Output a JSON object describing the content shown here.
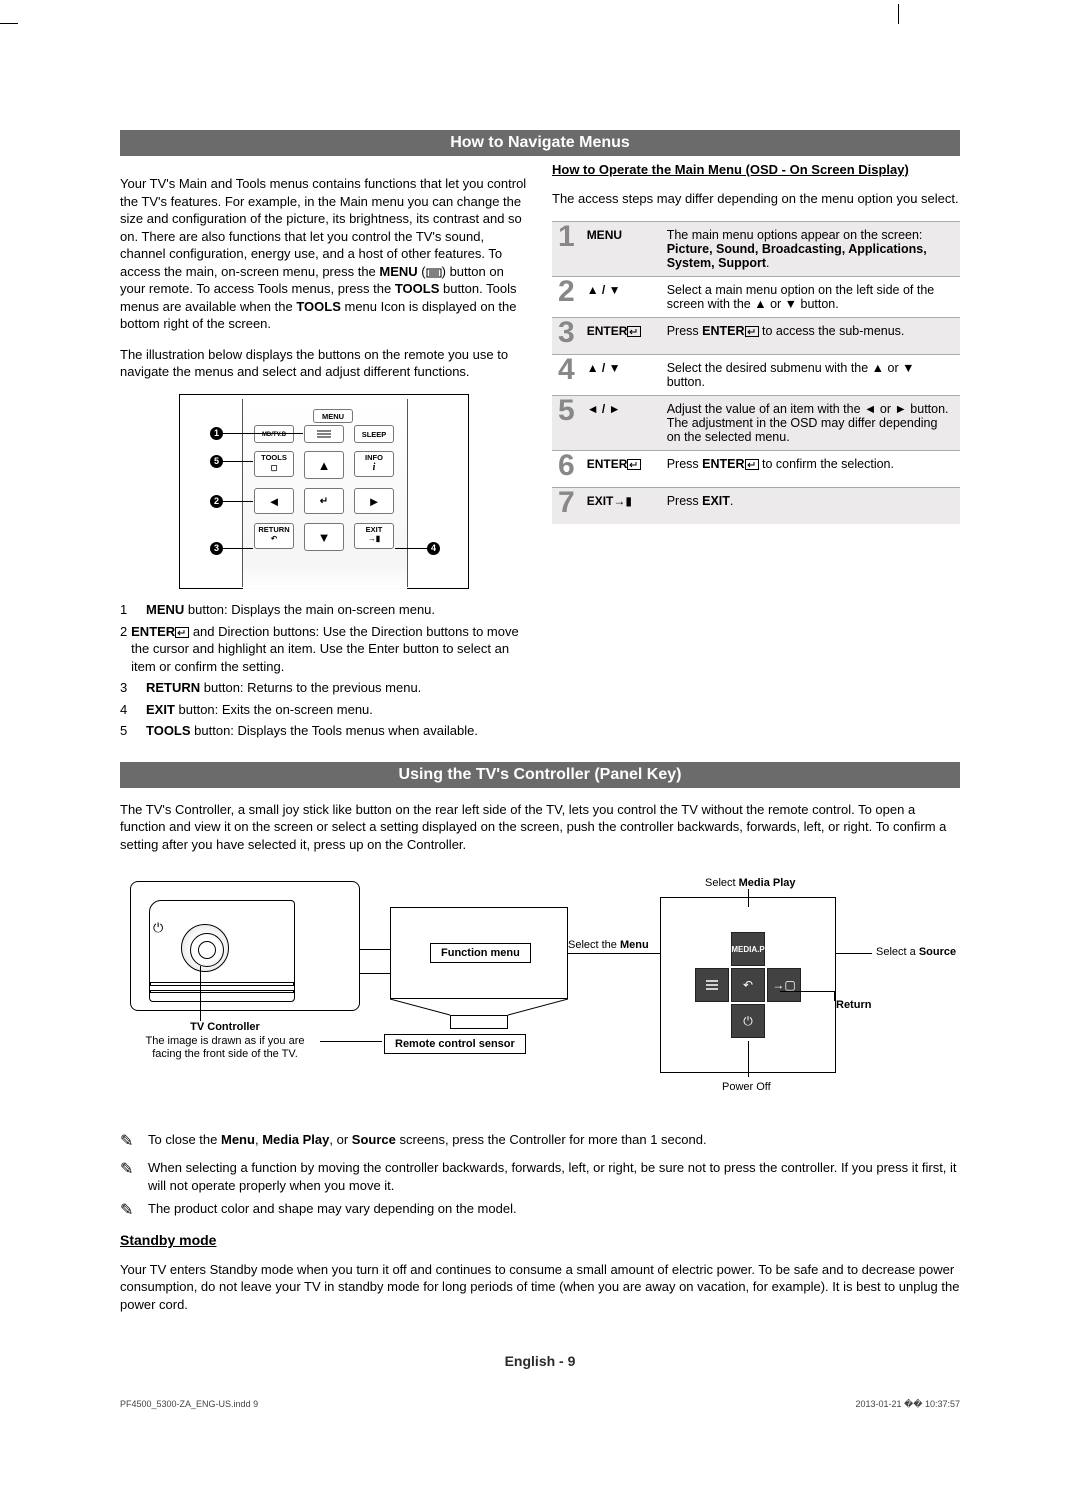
{
  "section1": {
    "title": "How to Navigate Menus",
    "intro1": "Your TV's Main and Tools menus contains functions that let you control the TV's features. For example, in the Main menu you can change the size and configuration of the picture, its brightness, its contrast and so on. There are also functions that let you control the TV's sound, channel configuration, energy use, and a host of other features. To access the main, on-screen menu, press the ",
    "intro1_menu": "MENU",
    "intro1_cont": " (",
    "intro1_end": ") button on your remote. To access Tools menus, press the ",
    "intro1_tools": "TOOLS",
    "intro1_end2": " button. Tools menus are available when the ",
    "intro1_tools2": "TOOLS",
    "intro1_end3": " menu Icon is displayed on the bottom right of the screen.",
    "intro2": "The illustration below displays the buttons on the remote you use to navigate the menus and select and adjust different functions.",
    "remote": {
      "menu": "MENU",
      "sleep": "SLEEP",
      "tools": "TOOLS",
      "info": "INFO",
      "return": "RETURN",
      "exit": "EXIT",
      "mdisc": "MD/TV.B"
    },
    "legend": [
      {
        "n": "1",
        "b": "MENU",
        "t": " button: Displays the main on-screen menu."
      },
      {
        "n": "2",
        "b": "ENTER",
        "t": " and Direction buttons: Use the Direction buttons to move the cursor and highlight an item. Use the Enter button to select an item or confirm the setting."
      },
      {
        "n": "3",
        "b": "RETURN",
        "t": " button: Returns to the previous menu."
      },
      {
        "n": "4",
        "b": "EXIT",
        "t": " button: Exits the on-screen menu."
      },
      {
        "n": "5",
        "b": "TOOLS",
        "t": " button: Displays the Tools menus when available."
      }
    ],
    "rightHeading": "How to Operate the Main Menu  (OSD - On Screen Display)",
    "rightSub": "The access steps may differ depending on the menu option you select.",
    "steps": [
      {
        "n": "1",
        "btn": "MENU",
        "desc_pre": "The main menu options appear on the screen:",
        "desc_bold": "Picture, Sound, Broadcasting, Applications, System, Support",
        "desc_suf": "."
      },
      {
        "n": "2",
        "btn": "▲ / ▼",
        "desc": "Select a main menu option on the left side of the screen with the ▲ or ▼ button."
      },
      {
        "n": "3",
        "btn": "ENTER",
        "enter": true,
        "desc_pre": "Press ",
        "desc_b": "ENTER",
        "desc_suf": " to access the sub-menus."
      },
      {
        "n": "4",
        "btn": "▲ / ▼",
        "desc": "Select the desired submenu with the ▲ or ▼ button."
      },
      {
        "n": "5",
        "btn": "◄ / ►",
        "desc": "Adjust the value of an item with the ◄ or ► button. The adjustment in the OSD may differ depending on the selected menu."
      },
      {
        "n": "6",
        "btn": "ENTER",
        "enter": true,
        "desc_pre": "Press ",
        "desc_b": "ENTER",
        "desc_suf": " to confirm the selection."
      },
      {
        "n": "7",
        "btn": "EXIT",
        "exit": true,
        "desc_pre": "Press ",
        "desc_b": "EXIT",
        "desc_suf": "."
      }
    ]
  },
  "section2": {
    "title": "Using the TV's Controller (Panel Key)",
    "para": "The TV's Controller, a small joy stick like button on the rear left side of the TV, lets you control the TV without the remote control. To open a function and view it on the screen or select a setting displayed on the screen, push the controller backwards, forwards, left, or right. To confirm a setting after you have selected it, press up on the Controller.",
    "labels": {
      "funcMenu": "Function menu",
      "tvController": "TV Controller",
      "tvControllerSub": "The image is drawn as if you are facing the front side of the TV.",
      "sensor": "Remote control sensor",
      "selectMedia": "Select",
      "selectMediaBold": "Media Play",
      "selectMenu": "Select the",
      "selectMenuBold": "Menu",
      "selectSource": "Select a",
      "selectSourceBold": "Source",
      "return": "Return",
      "powerOff": "Power Off",
      "mediap": "MEDIA.P"
    },
    "notes": [
      {
        "pre": "To close the ",
        "b1": "Menu",
        "m1": ", ",
        "b2": "Media Play",
        "m2": ", or ",
        "b3": "Source",
        "suf": " screens, press the Controller for more than 1 second."
      },
      {
        "txt": "When selecting a function by moving the controller backwards, forwards, left, or right, be sure not to press the controller. If you press it first, it will not operate properly when you move it."
      },
      {
        "txt": "The product color and shape may vary depending on the model."
      }
    ],
    "standbyTitle": "Standby mode",
    "standby": "Your TV enters Standby mode when you turn it off and continues to consume a small amount of electric power. To be safe and to decrease power consumption, do not leave your TV in standby mode for long periods of time (when you are away on vacation, for example). It is best to unplug the power cord."
  },
  "footer": {
    "lang": "English - 9",
    "file": "PF4500_5300-ZA_ENG-US.indd   9",
    "timestamp": "2013-01-21   �� 10:37:57"
  },
  "icons": {
    "enter": "E",
    "exitArrow": "→",
    "menuBars": "≡"
  }
}
